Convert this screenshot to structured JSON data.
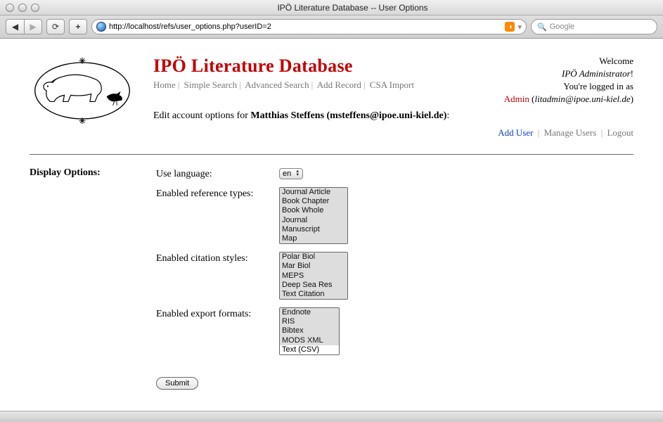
{
  "window": {
    "title": "IPÖ Literature Database -- User Options",
    "url": "http://localhost/refs/user_options.php?userID=2",
    "search_placeholder": "Google"
  },
  "site": {
    "title": "IPÖ Literature Database"
  },
  "nav": {
    "home": "Home",
    "simple_search": "Simple Search",
    "advanced_search": "Advanced Search",
    "add_record": "Add Record",
    "csa_import": "CSA Import"
  },
  "edit_line": {
    "prefix": "Edit account options for ",
    "user": "Matthias Steffens (msteffens@ipoe.uni-kiel.de)",
    "suffix": ":"
  },
  "welcome": {
    "l1": "Welcome",
    "l2_name": "IPÖ Administrator",
    "l2_bang": "!",
    "l3": "You're logged in as",
    "admin_label": "Admin",
    "email": "litadmin@ipoe.uni-kiel.de"
  },
  "user_actions": {
    "add_user": "Add User",
    "manage_users": "Manage Users",
    "logout": "Logout"
  },
  "options": {
    "section_title": "Display Options:",
    "language_label": "Use language:",
    "language_value": "en",
    "ref_types_label": "Enabled reference types:",
    "ref_types": [
      "Journal Article",
      "Book Chapter",
      "Book Whole",
      "Journal",
      "Manuscript",
      "Map"
    ],
    "cit_styles_label": "Enabled citation styles:",
    "cit_styles": [
      "Polar Biol",
      "Mar Biol",
      "MEPS",
      "Deep Sea Res",
      "Text Citation"
    ],
    "export_label": "Enabled export formats:",
    "export_formats": [
      "Endnote",
      "RIS",
      "Bibtex",
      "MODS XML",
      "Text (CSV)"
    ],
    "export_unselected_index": 4,
    "submit_label": "Submit"
  }
}
